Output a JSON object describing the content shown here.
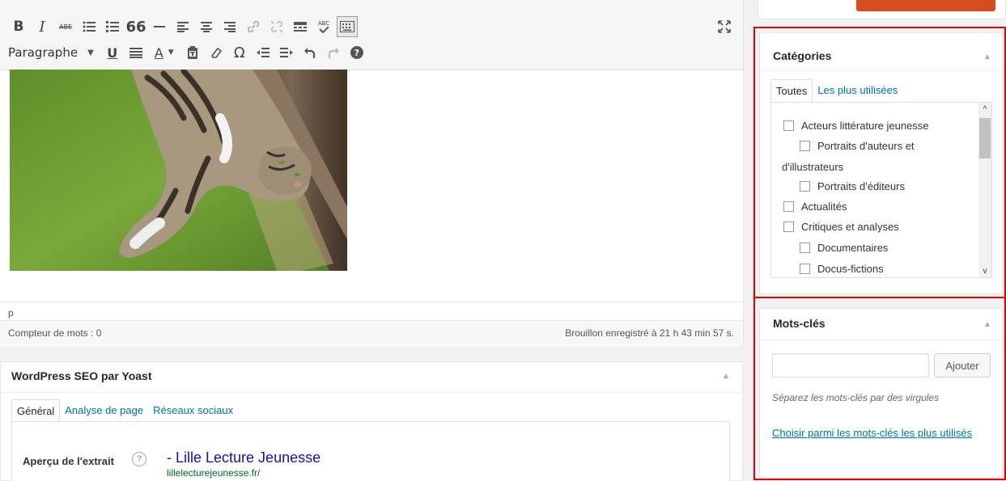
{
  "editor": {
    "toolbar_row1_icons": [
      "bold-icon",
      "italic-icon",
      "strikethrough-icon",
      "bullet-list-icon",
      "numbered-list-icon",
      "blockquote-icon",
      "horizontal-line-icon",
      "align-left-icon",
      "align-center-icon",
      "align-right-icon",
      "link-icon",
      "unlink-icon",
      "read-more-icon",
      "spellcheck-icon",
      "toolbar-toggle-icon"
    ],
    "bold_glyph": "B",
    "italic_glyph": "I",
    "strike_glyph": "ABE",
    "quote_glyph": "66",
    "spell_glyph": "ABC",
    "format_select": "Paragraphe",
    "underline_glyph": "U",
    "textcolor_glyph": "A",
    "omega_glyph": "Ω",
    "help_glyph": "?",
    "path": "p",
    "word_count": "Compteur de mots : 0",
    "draft_saved": "Brouillon enregistré à 21 h 43 min 57 s."
  },
  "seo": {
    "title": "WordPress SEO par Yoast",
    "tabs": [
      {
        "label": "Général"
      },
      {
        "label": "Analyse de page"
      },
      {
        "label": "Réseaux sociaux"
      }
    ],
    "apercu_label": "Aperçu de l'extrait",
    "help": "?",
    "snippet_title": "- Lille Lecture Jeunesse",
    "snippet_url": "lillelecturejeunesse.fr/"
  },
  "categories": {
    "title": "Catégories",
    "tabs": [
      {
        "label": "Toutes"
      },
      {
        "label": "Les plus utilisées"
      }
    ],
    "items": [
      {
        "label": "Acteurs littérature jeunesse",
        "checked": false
      },
      {
        "label": "Portraits d'auteurs et",
        "label2": "d'illustrateurs",
        "checked": false
      },
      {
        "label": "Portraits d'éditeurs",
        "checked": false
      },
      {
        "label": "Actualités",
        "checked": false
      },
      {
        "label": "Critiques et analyses",
        "checked": false
      },
      {
        "label": "Documentaires",
        "checked": false
      },
      {
        "label": "Docus-fictions",
        "checked": false
      }
    ]
  },
  "tags": {
    "title": "Mots-clés",
    "input_value": "",
    "add_label": "Ajouter",
    "hint": "Séparez les mots-clés par des virgules",
    "link": "Choisir parmi les mots-clés les plus utilisés"
  },
  "colors": {
    "highlight": "#e00000",
    "link": "#0073aa",
    "publish": "#d54e21",
    "snippet_title": "#1a0dab",
    "snippet_url": "#006621"
  }
}
